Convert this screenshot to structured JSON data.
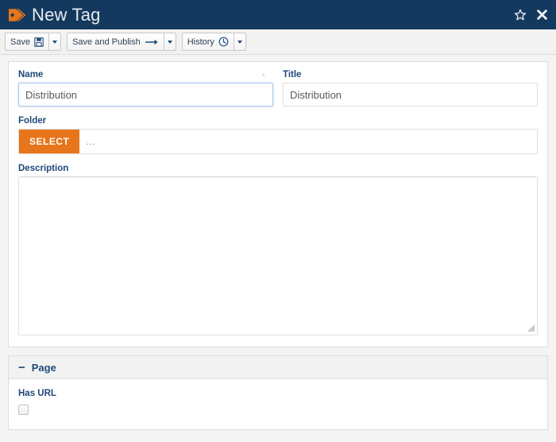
{
  "header": {
    "title": "New Tag",
    "icon": "tag-icon",
    "favorite_icon": "star-icon",
    "close_icon": "close-icon",
    "background_color": "#14395e",
    "accent_color": "#e8751a"
  },
  "toolbar": {
    "buttons": [
      {
        "label": "Save",
        "icon": "floppy-disk-icon",
        "has_dropdown": true
      },
      {
        "label": "Save and Publish",
        "icon": "arrow-right-icon",
        "has_dropdown": true
      },
      {
        "label": "History",
        "icon": "clock-icon",
        "has_dropdown": true
      }
    ]
  },
  "form": {
    "name": {
      "label": "Name",
      "value": "Distribution",
      "placeholder": "",
      "required_marker": "*",
      "focused": true
    },
    "title": {
      "label": "Title",
      "value": "Distribution",
      "placeholder": ""
    },
    "folder": {
      "label": "Folder",
      "button_label": "SELECT",
      "value": "...",
      "button_color": "#e8751a"
    },
    "description": {
      "label": "Description",
      "value": "",
      "placeholder": ""
    }
  },
  "page_section": {
    "title": "Page",
    "collapse_icon": "minus-icon",
    "expanded": true,
    "has_url": {
      "label": "Has URL",
      "checked": false
    }
  }
}
